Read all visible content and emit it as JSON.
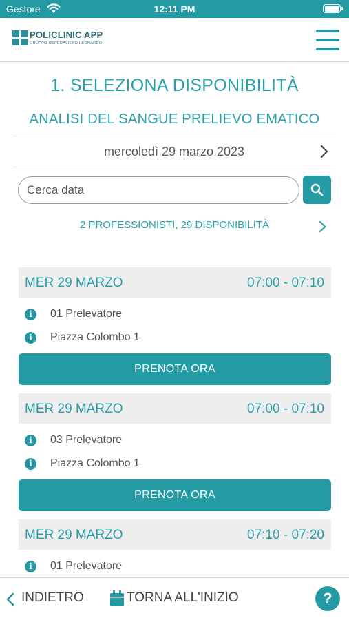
{
  "status_bar": {
    "carrier": "Gestore",
    "time": "12:11 PM"
  },
  "header": {
    "brand": "POLICLINIC APP",
    "tagline": "GRUPPO OSPEDALIERO LEONARDO"
  },
  "step_title": "1. SELEZIONA DISPONIBILITÀ",
  "service_title": "ANALISI DEL SANGUE PRELIEVO EMATICO",
  "date_nav": {
    "date": "mercoledì 29 marzo 2023"
  },
  "search": {
    "placeholder": "Cerca data"
  },
  "summary": "2 PROFESSIONISTI, 29 DISPONIBILITÀ",
  "slots": [
    {
      "date": "MER 29 MARZO",
      "time": "07:00 - 07:10",
      "professional": "01 Prelevatore",
      "location": "Piazza Colombo 1",
      "button": "PRENOTA ORA"
    },
    {
      "date": "MER 29 MARZO",
      "time": "07:00 - 07:10",
      "professional": "03 Prelevatore",
      "location": "Piazza Colombo 1",
      "button": "PRENOTA ORA"
    },
    {
      "date": "MER 29 MARZO",
      "time": "07:10 - 07:20",
      "professional": "01 Prelevatore"
    }
  ],
  "bottom_bar": {
    "back": "INDIETRO",
    "home": "TORNA ALL'INIZIO",
    "help": "?"
  },
  "colors": {
    "accent": "#239aa4",
    "text_accent": "#2aa1aa",
    "header_bg": "#eeeeee"
  },
  "icons": [
    "wifi-icon",
    "battery-icon",
    "menu-icon",
    "chevron-right-icon",
    "search-icon",
    "info-icon",
    "chevron-left-icon",
    "calendar-icon",
    "help-icon"
  ]
}
